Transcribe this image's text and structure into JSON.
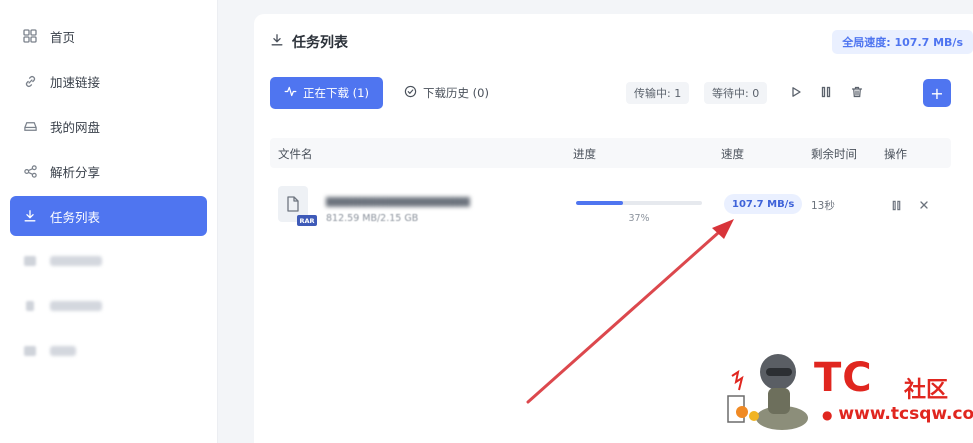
{
  "sidebar": {
    "items": [
      {
        "label": "首页",
        "icon": "grid-icon",
        "active": false,
        "blurred": false
      },
      {
        "label": "加速链接",
        "icon": "link-icon",
        "active": false,
        "blurred": false
      },
      {
        "label": "我的网盘",
        "icon": "drive-icon",
        "active": false,
        "blurred": false
      },
      {
        "label": "解析分享",
        "icon": "share-icon",
        "active": false,
        "blurred": false
      },
      {
        "label": "任务列表",
        "icon": "download-icon",
        "active": true,
        "blurred": false
      }
    ]
  },
  "header": {
    "title": "任务列表",
    "global_speed": "全局速度: 107.7 MB/s"
  },
  "toolbar": {
    "downloading_tab": "正在下载 (1)",
    "history_tab": "下载历史 (0)",
    "transferring": "传输中: 1",
    "waiting": "等待中: 0",
    "add_label": "+"
  },
  "table": {
    "columns": [
      "文件名",
      "进度",
      "速度",
      "剩余时间",
      "操作"
    ],
    "rows": [
      {
        "file_type": "RAR",
        "size": "812.59 MB/2.15 GB",
        "progress_percent": 37,
        "progress_label": "37%",
        "speed": "107.7 MB/s",
        "remaining": "13秒"
      }
    ]
  },
  "watermark": {
    "brand": "TC",
    "suffix": "社区",
    "url": "www.tcsqw.com"
  },
  "colors": {
    "accent": "#4f75f0",
    "arrow": "#d8343a",
    "watermark": "#e0261f"
  }
}
